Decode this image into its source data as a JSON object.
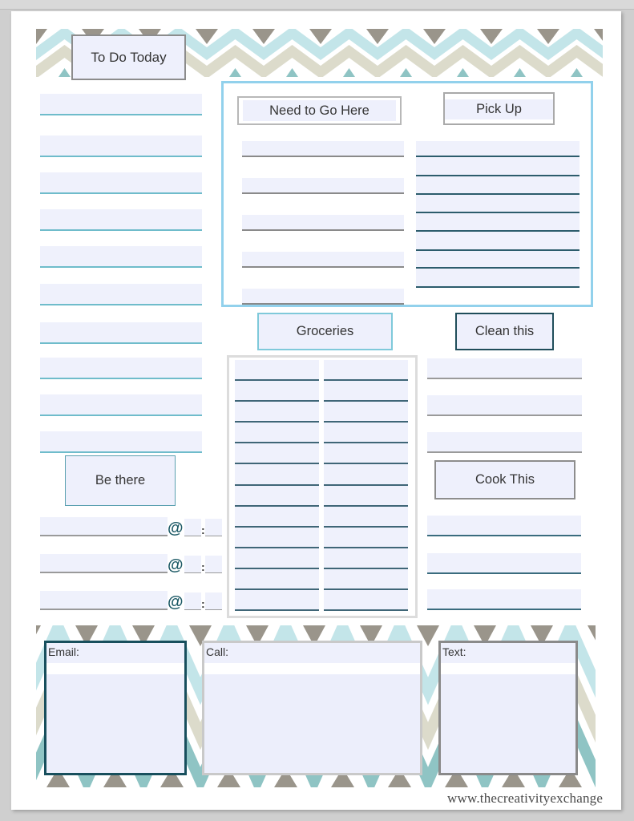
{
  "planner": {
    "to_do": {
      "title": "To Do Today",
      "items": [
        "",
        "",
        "",
        "",
        "",
        "",
        "",
        "",
        "",
        ""
      ]
    },
    "need_to_go": {
      "title": "Need to Go Here",
      "items": [
        "",
        "",
        "",
        "",
        ""
      ]
    },
    "pick_up": {
      "title": "Pick Up",
      "items": [
        "",
        "",
        "",
        "",
        "",
        "",
        "",
        ""
      ]
    },
    "groceries": {
      "title": "Groceries",
      "columns": [
        [
          "",
          "",
          "",
          "",
          "",
          "",
          "",
          "",
          "",
          "",
          "",
          ""
        ],
        [
          "",
          "",
          "",
          "",
          "",
          "",
          "",
          "",
          "",
          "",
          "",
          ""
        ]
      ]
    },
    "clean_this": {
      "title": "Clean this",
      "items": [
        "",
        "",
        ""
      ]
    },
    "cook_this": {
      "title": "Cook This",
      "items": [
        "",
        "",
        ""
      ]
    },
    "be_there": {
      "title": "Be there",
      "at_symbol": "@",
      "time_separator": ":",
      "items": [
        {
          "event": "",
          "hour": "",
          "minute": ""
        },
        {
          "event": "",
          "hour": "",
          "minute": ""
        },
        {
          "event": "",
          "hour": "",
          "minute": ""
        }
      ]
    },
    "contacts": {
      "email_label": "Email:",
      "call_label": "Call:",
      "text_label": "Text:",
      "email_value": "",
      "call_value": "",
      "text_value": ""
    },
    "watermark": "www.thecreativityexchange"
  },
  "colors": {
    "lavender_fill": "#eef0fc",
    "chevron_gray": "#9a958b",
    "chevron_blue": "#c3e5e9",
    "chevron_beige": "#dcdbcb",
    "chevron_teal": "#8fc4c4",
    "dark_teal": "#1d5a66",
    "sky_border": "#92d1ec"
  }
}
